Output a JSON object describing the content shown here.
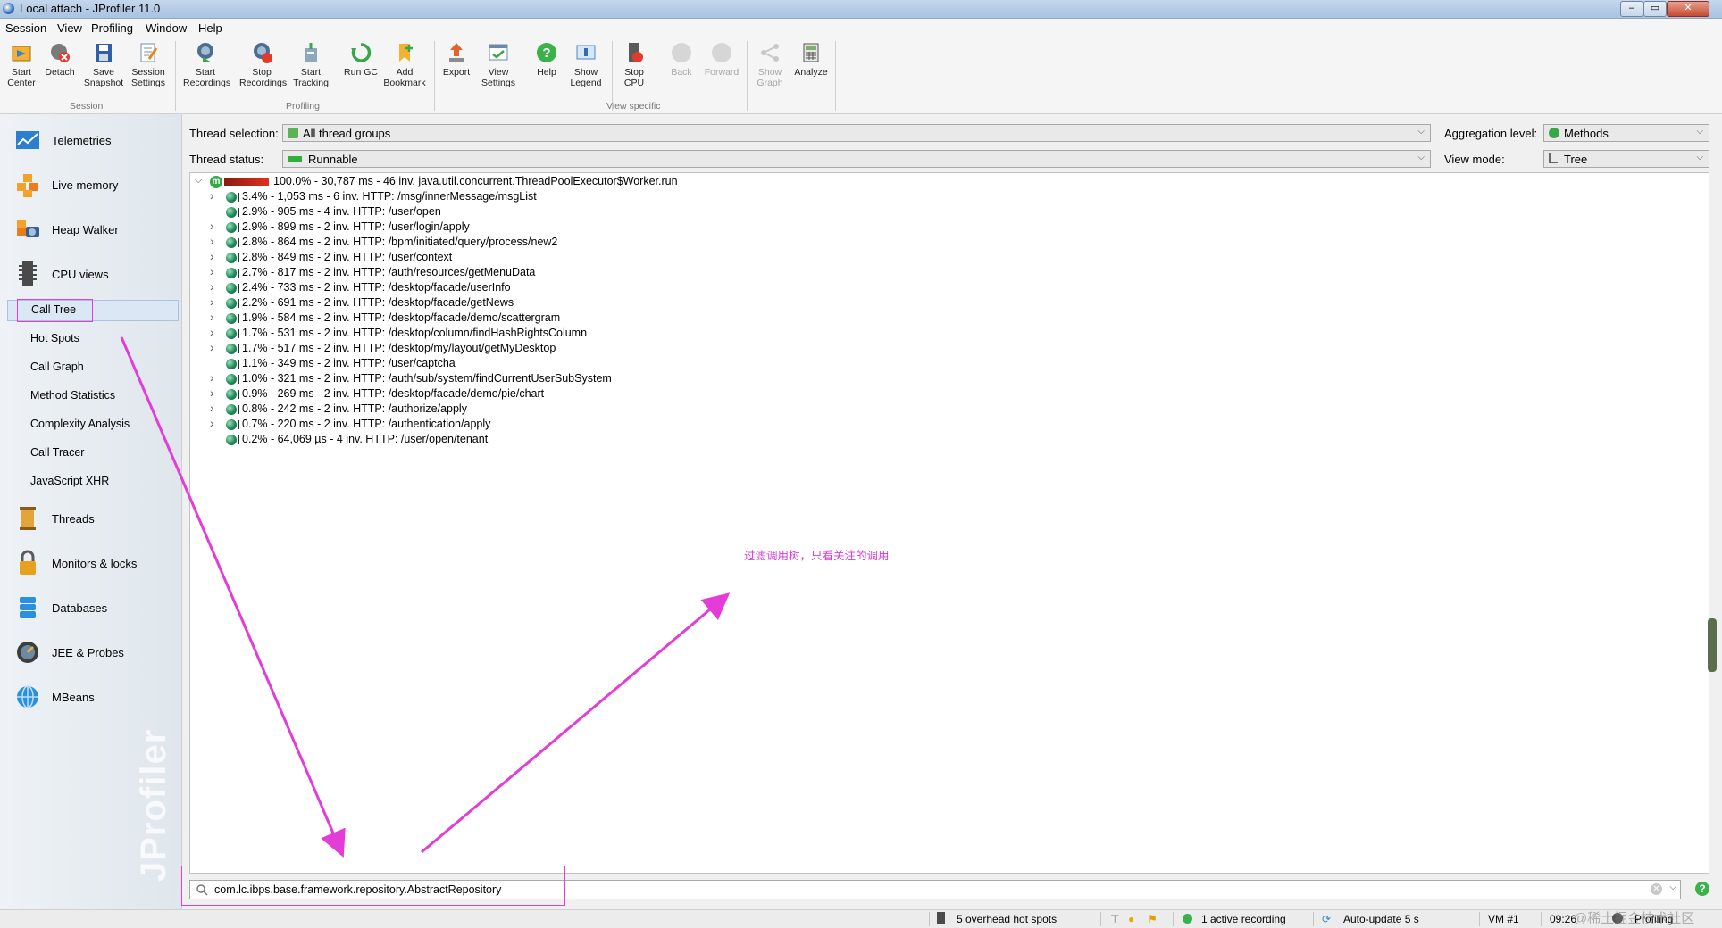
{
  "window": {
    "title": "Local attach - JProfiler 11.0"
  },
  "menu": [
    "Session",
    "View",
    "Profiling",
    "Window",
    "Help"
  ],
  "toolbar": {
    "buttons": [
      {
        "label": "Start\nCenter",
        "icon": "start-center-icon"
      },
      {
        "label": "Detach",
        "icon": "detach-icon"
      },
      {
        "label": "Save\nSnapshot",
        "icon": "save-snapshot-icon"
      },
      {
        "label": "Session\nSettings",
        "icon": "session-settings-icon"
      },
      {
        "label": "Start\nRecordings",
        "icon": "start-recordings-icon"
      },
      {
        "label": "Stop\nRecordings",
        "icon": "stop-recordings-icon"
      },
      {
        "label": "Start\nTracking",
        "icon": "start-tracking-icon"
      },
      {
        "label": "Run GC",
        "icon": "run-gc-icon"
      },
      {
        "label": "Add\nBookmark",
        "icon": "add-bookmark-icon"
      },
      {
        "label": "Export",
        "icon": "export-icon"
      },
      {
        "label": "View\nSettings",
        "icon": "view-settings-icon"
      },
      {
        "label": "Help",
        "icon": "help-icon"
      },
      {
        "label": "Show\nLegend",
        "icon": "show-legend-icon"
      },
      {
        "label": "Stop\nCPU",
        "icon": "stop-cpu-icon"
      },
      {
        "label": "Back",
        "icon": "back-icon"
      },
      {
        "label": "Forward",
        "icon": "forward-icon"
      },
      {
        "label": "Show\nGraph",
        "icon": "show-graph-icon"
      },
      {
        "label": "Analyze",
        "icon": "analyze-icon"
      }
    ],
    "groups": [
      "Session",
      "Profiling",
      "View specific"
    ]
  },
  "sidebar": {
    "sections": [
      {
        "label": "Telemetries",
        "icon": "telemetries-icon"
      },
      {
        "label": "Live memory",
        "icon": "live-memory-icon"
      },
      {
        "label": "Heap Walker",
        "icon": "heap-walker-icon"
      },
      {
        "label": "CPU views",
        "icon": "cpu-views-icon"
      },
      {
        "label": "Threads",
        "icon": "threads-icon"
      },
      {
        "label": "Monitors & locks",
        "icon": "monitors-locks-icon"
      },
      {
        "label": "Databases",
        "icon": "databases-icon"
      },
      {
        "label": "JEE & Probes",
        "icon": "jee-probes-icon"
      },
      {
        "label": "MBeans",
        "icon": "mbeans-icon"
      }
    ],
    "cpu_sub": [
      "Call Tree",
      "Hot Spots",
      "Call Graph",
      "Method Statistics",
      "Complexity Analysis",
      "Call Tracer",
      "JavaScript XHR"
    ],
    "selected": "Call Tree",
    "watermark": "JProfiler"
  },
  "filters": {
    "thread_selection_label": "Thread selection:",
    "thread_selection_value": "All thread groups",
    "thread_status_label": "Thread status:",
    "thread_status_value": "Runnable",
    "aggregation_label": "Aggregation level:",
    "aggregation_value": "Methods",
    "view_mode_label": "View mode:",
    "view_mode_value": "Tree"
  },
  "tree": {
    "root": "100.0% - 30,787 ms - 46 inv. java.util.concurrent.ThreadPoolExecutor$Worker.run",
    "root_badge": "m",
    "rows": [
      {
        "text": "3.4% - 1,053 ms - 6 inv. HTTP: /msg/innerMessage/msgList",
        "expandable": true
      },
      {
        "text": "2.9% - 905 ms - 4 inv. HTTP: /user/open",
        "expandable": false
      },
      {
        "text": "2.9% - 899 ms - 2 inv. HTTP: /user/login/apply",
        "expandable": true
      },
      {
        "text": "2.8% - 864 ms - 2 inv. HTTP: /bpm/initiated/query/process/new2",
        "expandable": true
      },
      {
        "text": "2.8% - 849 ms - 2 inv. HTTP: /user/context",
        "expandable": true
      },
      {
        "text": "2.7% - 817 ms - 2 inv. HTTP: /auth/resources/getMenuData",
        "expandable": true
      },
      {
        "text": "2.4% - 733 ms - 2 inv. HTTP: /desktop/facade/userInfo",
        "expandable": true
      },
      {
        "text": "2.2% - 691 ms - 2 inv. HTTP: /desktop/facade/getNews",
        "expandable": true
      },
      {
        "text": "1.9% - 584 ms - 2 inv. HTTP: /desktop/facade/demo/scattergram",
        "expandable": true
      },
      {
        "text": "1.7% - 531 ms - 2 inv. HTTP: /desktop/column/findHashRightsColumn",
        "expandable": true
      },
      {
        "text": "1.7% - 517 ms - 2 inv. HTTP: /desktop/my/layout/getMyDesktop",
        "expandable": true
      },
      {
        "text": "1.1% - 349 ms - 2 inv. HTTP: /user/captcha",
        "expandable": false
      },
      {
        "text": "1.0% - 321 ms - 2 inv. HTTP: /auth/sub/system/findCurrentUserSubSystem",
        "expandable": true
      },
      {
        "text": "0.9% - 269 ms - 2 inv. HTTP: /desktop/facade/demo/pie/chart",
        "expandable": true
      },
      {
        "text": "0.8% - 242 ms - 2 inv. HTTP: /authorize/apply",
        "expandable": true
      },
      {
        "text": "0.7% - 220 ms - 2 inv. HTTP: /authentication/apply",
        "expandable": true
      },
      {
        "text": "0.2% - 64,069 µs - 4 inv. HTTP: /user/open/tenant",
        "expandable": false
      }
    ]
  },
  "annotation": "过滤调用树，只看关注的调用",
  "filter_bar": {
    "value": "com.lc.ibps.base.framework.repository.AbstractRepository"
  },
  "status": {
    "hot_spots": "5 overhead hot spots",
    "recording": "1 active recording",
    "auto_update": "Auto-update 5 s",
    "vm": "VM #1",
    "time": "09:26",
    "mode": "Profiling",
    "watermark": "@稀土掘金技术社区"
  },
  "colors": {
    "annotation": "#e43cd6",
    "accent": "#2d6fb6"
  }
}
